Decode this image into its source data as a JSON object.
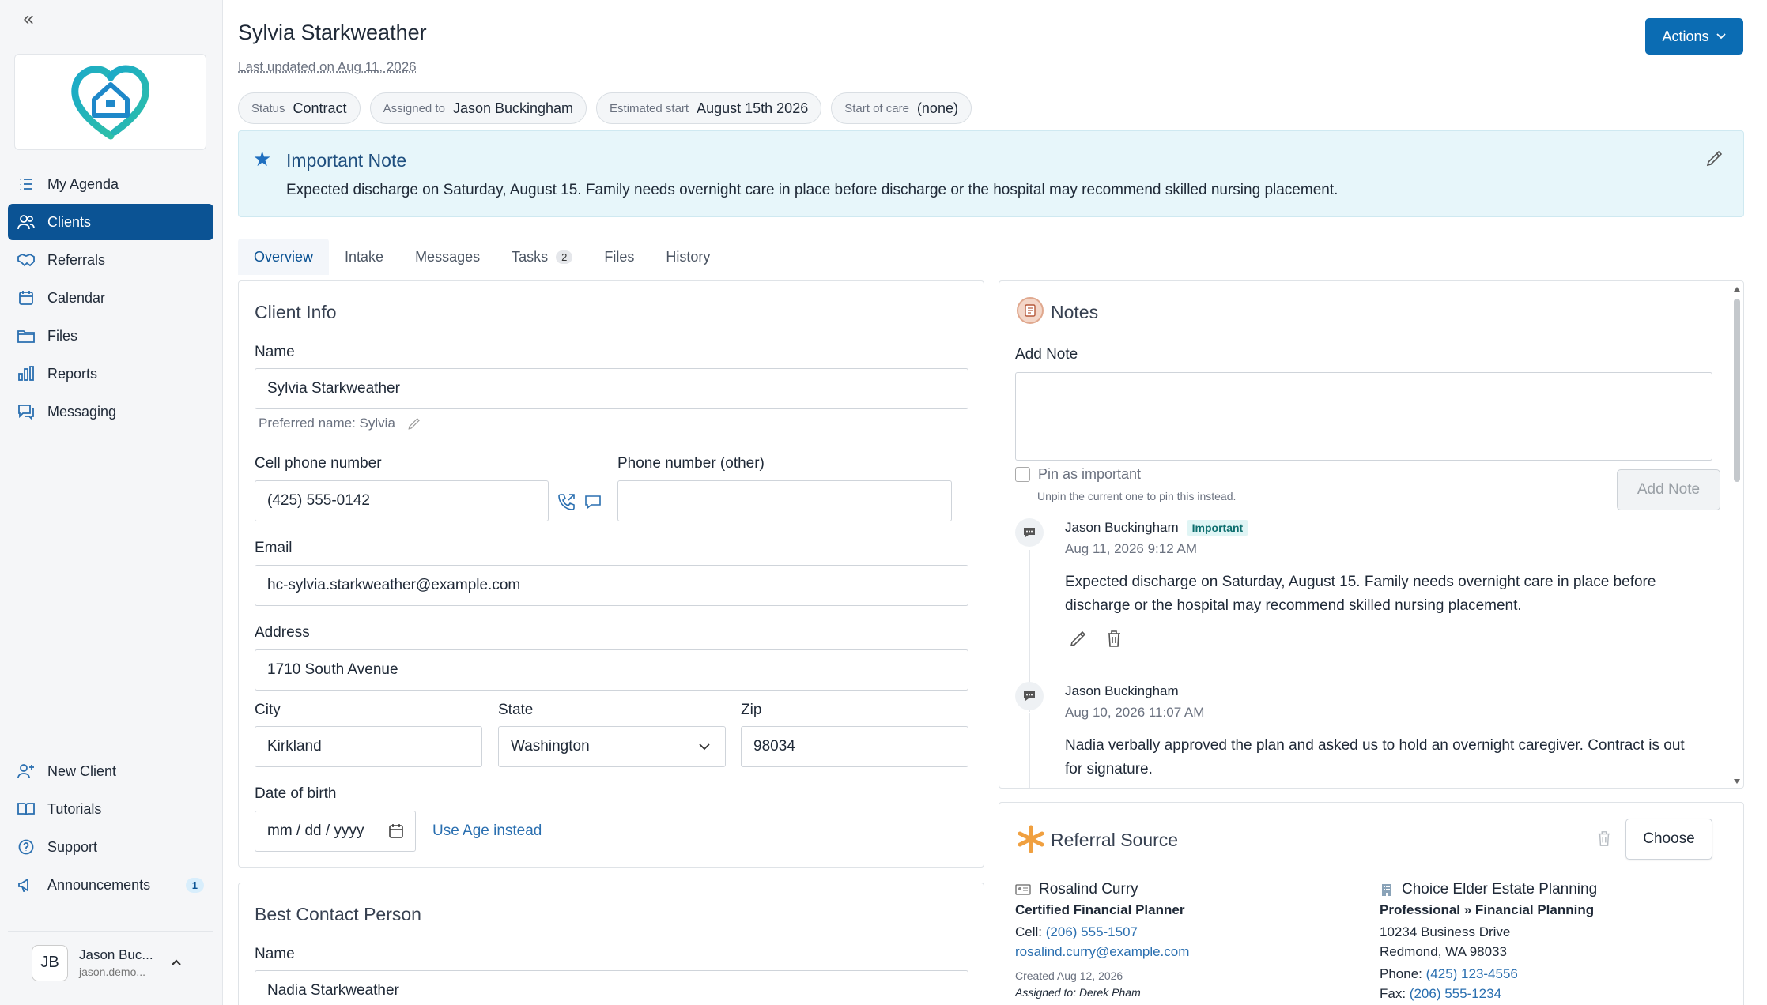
{
  "sidebar": {
    "nav": [
      {
        "label": "My Agenda",
        "icon": "list-icon"
      },
      {
        "label": "Clients",
        "icon": "users-icon"
      },
      {
        "label": "Referrals",
        "icon": "handshake-icon"
      },
      {
        "label": "Calendar",
        "icon": "calendar-icon"
      },
      {
        "label": "Files",
        "icon": "folder-icon"
      },
      {
        "label": "Reports",
        "icon": "bar-chart-icon"
      },
      {
        "label": "Messaging",
        "icon": "chat-icon"
      }
    ],
    "bottom": [
      {
        "label": "New Client",
        "icon": "user-plus-icon"
      },
      {
        "label": "Tutorials",
        "icon": "book-icon"
      },
      {
        "label": "Support",
        "icon": "question-icon"
      },
      {
        "label": "Announcements",
        "icon": "megaphone-icon",
        "count": "1"
      }
    ],
    "user": {
      "initials": "JB",
      "name": "Jason Buc...",
      "email": "jason.demo..."
    }
  },
  "header": {
    "title": "Sylvia Starkweather",
    "last_updated": "Last updated on Aug 11, 2026",
    "actions_label": "Actions",
    "pills": [
      {
        "label": "Status",
        "value": "Contract"
      },
      {
        "label": "Assigned to",
        "value": "Jason Buckingham"
      },
      {
        "label": "Estimated start",
        "value": "August 15th 2026"
      },
      {
        "label": "Start of care",
        "value": "(none)"
      }
    ]
  },
  "important_note": {
    "title": "Important Note",
    "text": "Expected discharge on Saturday, August 15. Family needs overnight care in place before discharge or the hospital may recommend skilled nursing placement."
  },
  "tabs": [
    {
      "label": "Overview"
    },
    {
      "label": "Intake"
    },
    {
      "label": "Messages"
    },
    {
      "label": "Tasks",
      "count": "2"
    },
    {
      "label": "Files"
    },
    {
      "label": "History"
    }
  ],
  "client_info": {
    "title": "Client Info",
    "name_label": "Name",
    "name": "Sylvia Starkweather",
    "preferred": "Preferred name: Sylvia",
    "cell_label": "Cell phone number",
    "cell": "(425) 555-0142",
    "other_phone_label": "Phone number (other)",
    "other_phone": "",
    "email_label": "Email",
    "email": "hc-sylvia.starkweather@example.com",
    "address_label": "Address",
    "address": "1710 South Avenue",
    "city_label": "City",
    "city": "Kirkland",
    "state_label": "State",
    "state": "Washington",
    "zip_label": "Zip",
    "zip": "98034",
    "dob_label": "Date of birth",
    "dob_placeholder": "mm / dd / yyyy",
    "use_age": "Use Age instead"
  },
  "best_contact": {
    "title": "Best Contact Person",
    "name_label": "Name",
    "name": "Nadia Starkweather"
  },
  "notes": {
    "title": "Notes",
    "add_label": "Add Note",
    "pin_label": "Pin as important",
    "pin_sub": "Unpin the current one to pin this instead.",
    "add_button": "Add Note",
    "items": [
      {
        "author": "Jason Buckingham",
        "badge": "Important",
        "date": "Aug 11, 2026 9:12 AM",
        "text": "Expected discharge on Saturday, August 15. Family needs overnight care in place before discharge or the hospital may recommend skilled nursing placement."
      },
      {
        "author": "Jason Buckingham",
        "badge": "",
        "date": "Aug 10, 2026 11:07 AM",
        "text": "Nadia verbally approved the plan and asked us to hold an overnight caregiver. Contract is out for signature."
      }
    ]
  },
  "referral": {
    "title": "Referral Source",
    "choose": "Choose",
    "person": {
      "name": "Rosalind Curry",
      "role": "Certified Financial Planner",
      "cell_label": "Cell:",
      "cell": "(206) 555-1507",
      "email": "rosalind.curry@example.com",
      "created": "Created Aug 12, 2026",
      "assigned": "Assigned to: Derek Pham"
    },
    "org": {
      "name": "Choice Elder Estate Planning",
      "category": "Professional » Financial Planning",
      "address1": "10234 Business Drive",
      "address2": "Redmond, WA 98033",
      "phone_label": "Phone:",
      "phone": "(425) 123-4556",
      "fax_label": "Fax:",
      "fax": "(206) 555-1234"
    }
  }
}
